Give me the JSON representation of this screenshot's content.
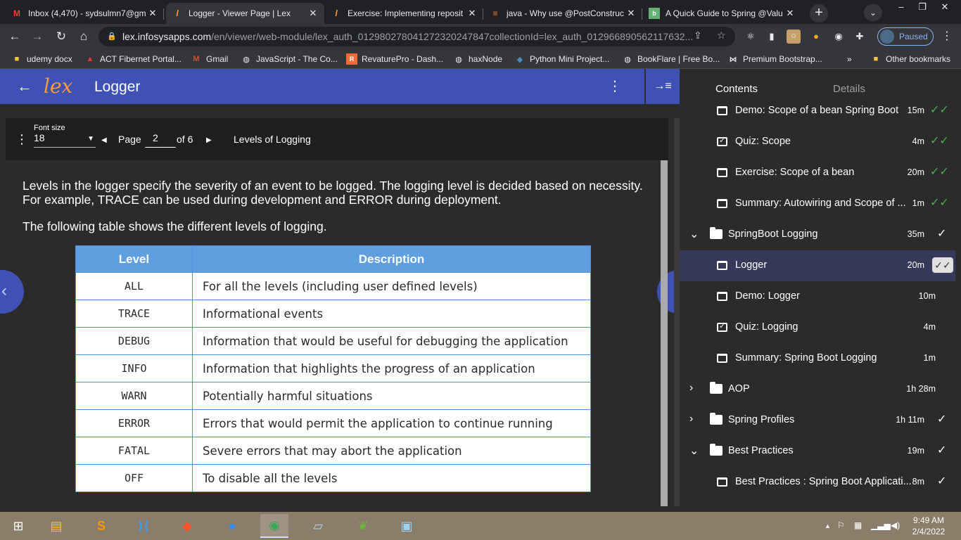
{
  "browser": {
    "tabs": [
      {
        "title": "Inbox (4,470) - sydsulmn7@gm",
        "icon": "gmail-icon",
        "active": false
      },
      {
        "title": "Logger - Viewer Page | Lex",
        "icon": "lex-icon",
        "active": true
      },
      {
        "title": "Exercise: Implementing reposit",
        "icon": "lex-icon",
        "active": false
      },
      {
        "title": "java - Why use @PostConstruc",
        "icon": "stackoverflow-icon",
        "active": false
      },
      {
        "title": "A Quick Guide to Spring @Valu",
        "icon": "baeldung-icon",
        "active": false
      }
    ],
    "url_host": "lex.infosysapps.com",
    "url_path": "/en/viewer/web-module/lex_auth_012980278041272320247847collectionId=lex_auth_012966890562117632...",
    "profile_status": "Paused",
    "bookmarks": [
      {
        "label": "udemy docx",
        "icon": "folder-icon"
      },
      {
        "label": "ACT Fibernet Portal...",
        "icon": "act-icon"
      },
      {
        "label": "Gmail",
        "icon": "gmail-icon"
      },
      {
        "label": "JavaScript - The Co...",
        "icon": "globe-icon"
      },
      {
        "label": "RevaturePro - Dash...",
        "icon": "revature-icon"
      },
      {
        "label": "haxNode",
        "icon": "globe-icon"
      },
      {
        "label": "Python Mini Project...",
        "icon": "python-icon"
      },
      {
        "label": "BookFlare | Free Bo...",
        "icon": "globe-icon"
      },
      {
        "label": "Premium Bootstrap...",
        "icon": "bootstrap-icon"
      }
    ],
    "bookmarks_overflow": "»",
    "other_bookmarks": "Other bookmarks"
  },
  "app": {
    "title": "Logger"
  },
  "viewer": {
    "font_size_label": "Font size",
    "font_size_value": "18",
    "page_label": "Page",
    "page_value": "2",
    "page_of": "of 6",
    "section_title": "Levels of Logging",
    "paragraph_1_line_1": "Levels in the logger specify the severity of an event to be logged. The logging level is decided based on necessity.",
    "paragraph_1_line_2": "For example, TRACE can be used during development and ERROR during deployment.",
    "paragraph_2": "The following table shows the different levels of logging.",
    "table": {
      "headers": [
        "Level",
        "Description"
      ],
      "rows": [
        [
          "ALL",
          "For all the levels (including user defined levels)"
        ],
        [
          "TRACE",
          "Informational events"
        ],
        [
          "DEBUG",
          "Information that would be useful for debugging the application"
        ],
        [
          "INFO",
          "Information that highlights the progress of an application"
        ],
        [
          "WARN",
          "Potentially harmful situations"
        ],
        [
          "ERROR",
          "Errors  that would permit the application to continue running"
        ],
        [
          "FATAL",
          "Severe errors  that may abort the application"
        ],
        [
          "OFF",
          "To disable all the levels"
        ]
      ]
    }
  },
  "panel": {
    "tab_contents": "Contents",
    "tab_details": "Details",
    "items": [
      {
        "type": "module",
        "label": "Demo: Scope of a bean Spring Boot",
        "duration": "15m",
        "status": "double-check-green"
      },
      {
        "type": "quiz",
        "label": "Quiz: Scope",
        "duration": "4m",
        "status": "double-check-green"
      },
      {
        "type": "module",
        "label": "Exercise: Scope of a bean",
        "duration": "20m",
        "status": "double-check-green"
      },
      {
        "type": "module",
        "label": "Summary: Autowiring and Scope of ...",
        "duration": "1m",
        "status": "double-check-green"
      },
      {
        "type": "folder",
        "expanded": true,
        "label": "SpringBoot Logging",
        "duration": "35m",
        "status": "check-white"
      },
      {
        "type": "module",
        "label": "Logger",
        "duration": "20m",
        "status": "double-check-box",
        "selected": true
      },
      {
        "type": "module",
        "label": "Demo: Logger",
        "duration": "10m",
        "status": ""
      },
      {
        "type": "quiz",
        "label": "Quiz: Logging",
        "duration": "4m",
        "status": ""
      },
      {
        "type": "module",
        "label": "Summary: Spring Boot Logging",
        "duration": "1m",
        "status": ""
      },
      {
        "type": "folder",
        "expanded": false,
        "label": "AOP",
        "duration": "1h 28m",
        "status": ""
      },
      {
        "type": "folder",
        "expanded": false,
        "label": "Spring Profiles",
        "duration": "1h 11m",
        "status": "check-white"
      },
      {
        "type": "folder",
        "expanded": true,
        "label": "Best Practices",
        "duration": "19m",
        "status": "check-white"
      },
      {
        "type": "module",
        "label": "Best Practices : Spring Boot Applicati...",
        "duration": "8m",
        "status": "check-white"
      }
    ]
  },
  "taskbar": {
    "time": "9:49 AM",
    "date": "2/4/2022"
  },
  "colors": {
    "header_blue": "#3f51b5",
    "table_header": "#5f9fe0",
    "done_green": "#4caf50"
  }
}
